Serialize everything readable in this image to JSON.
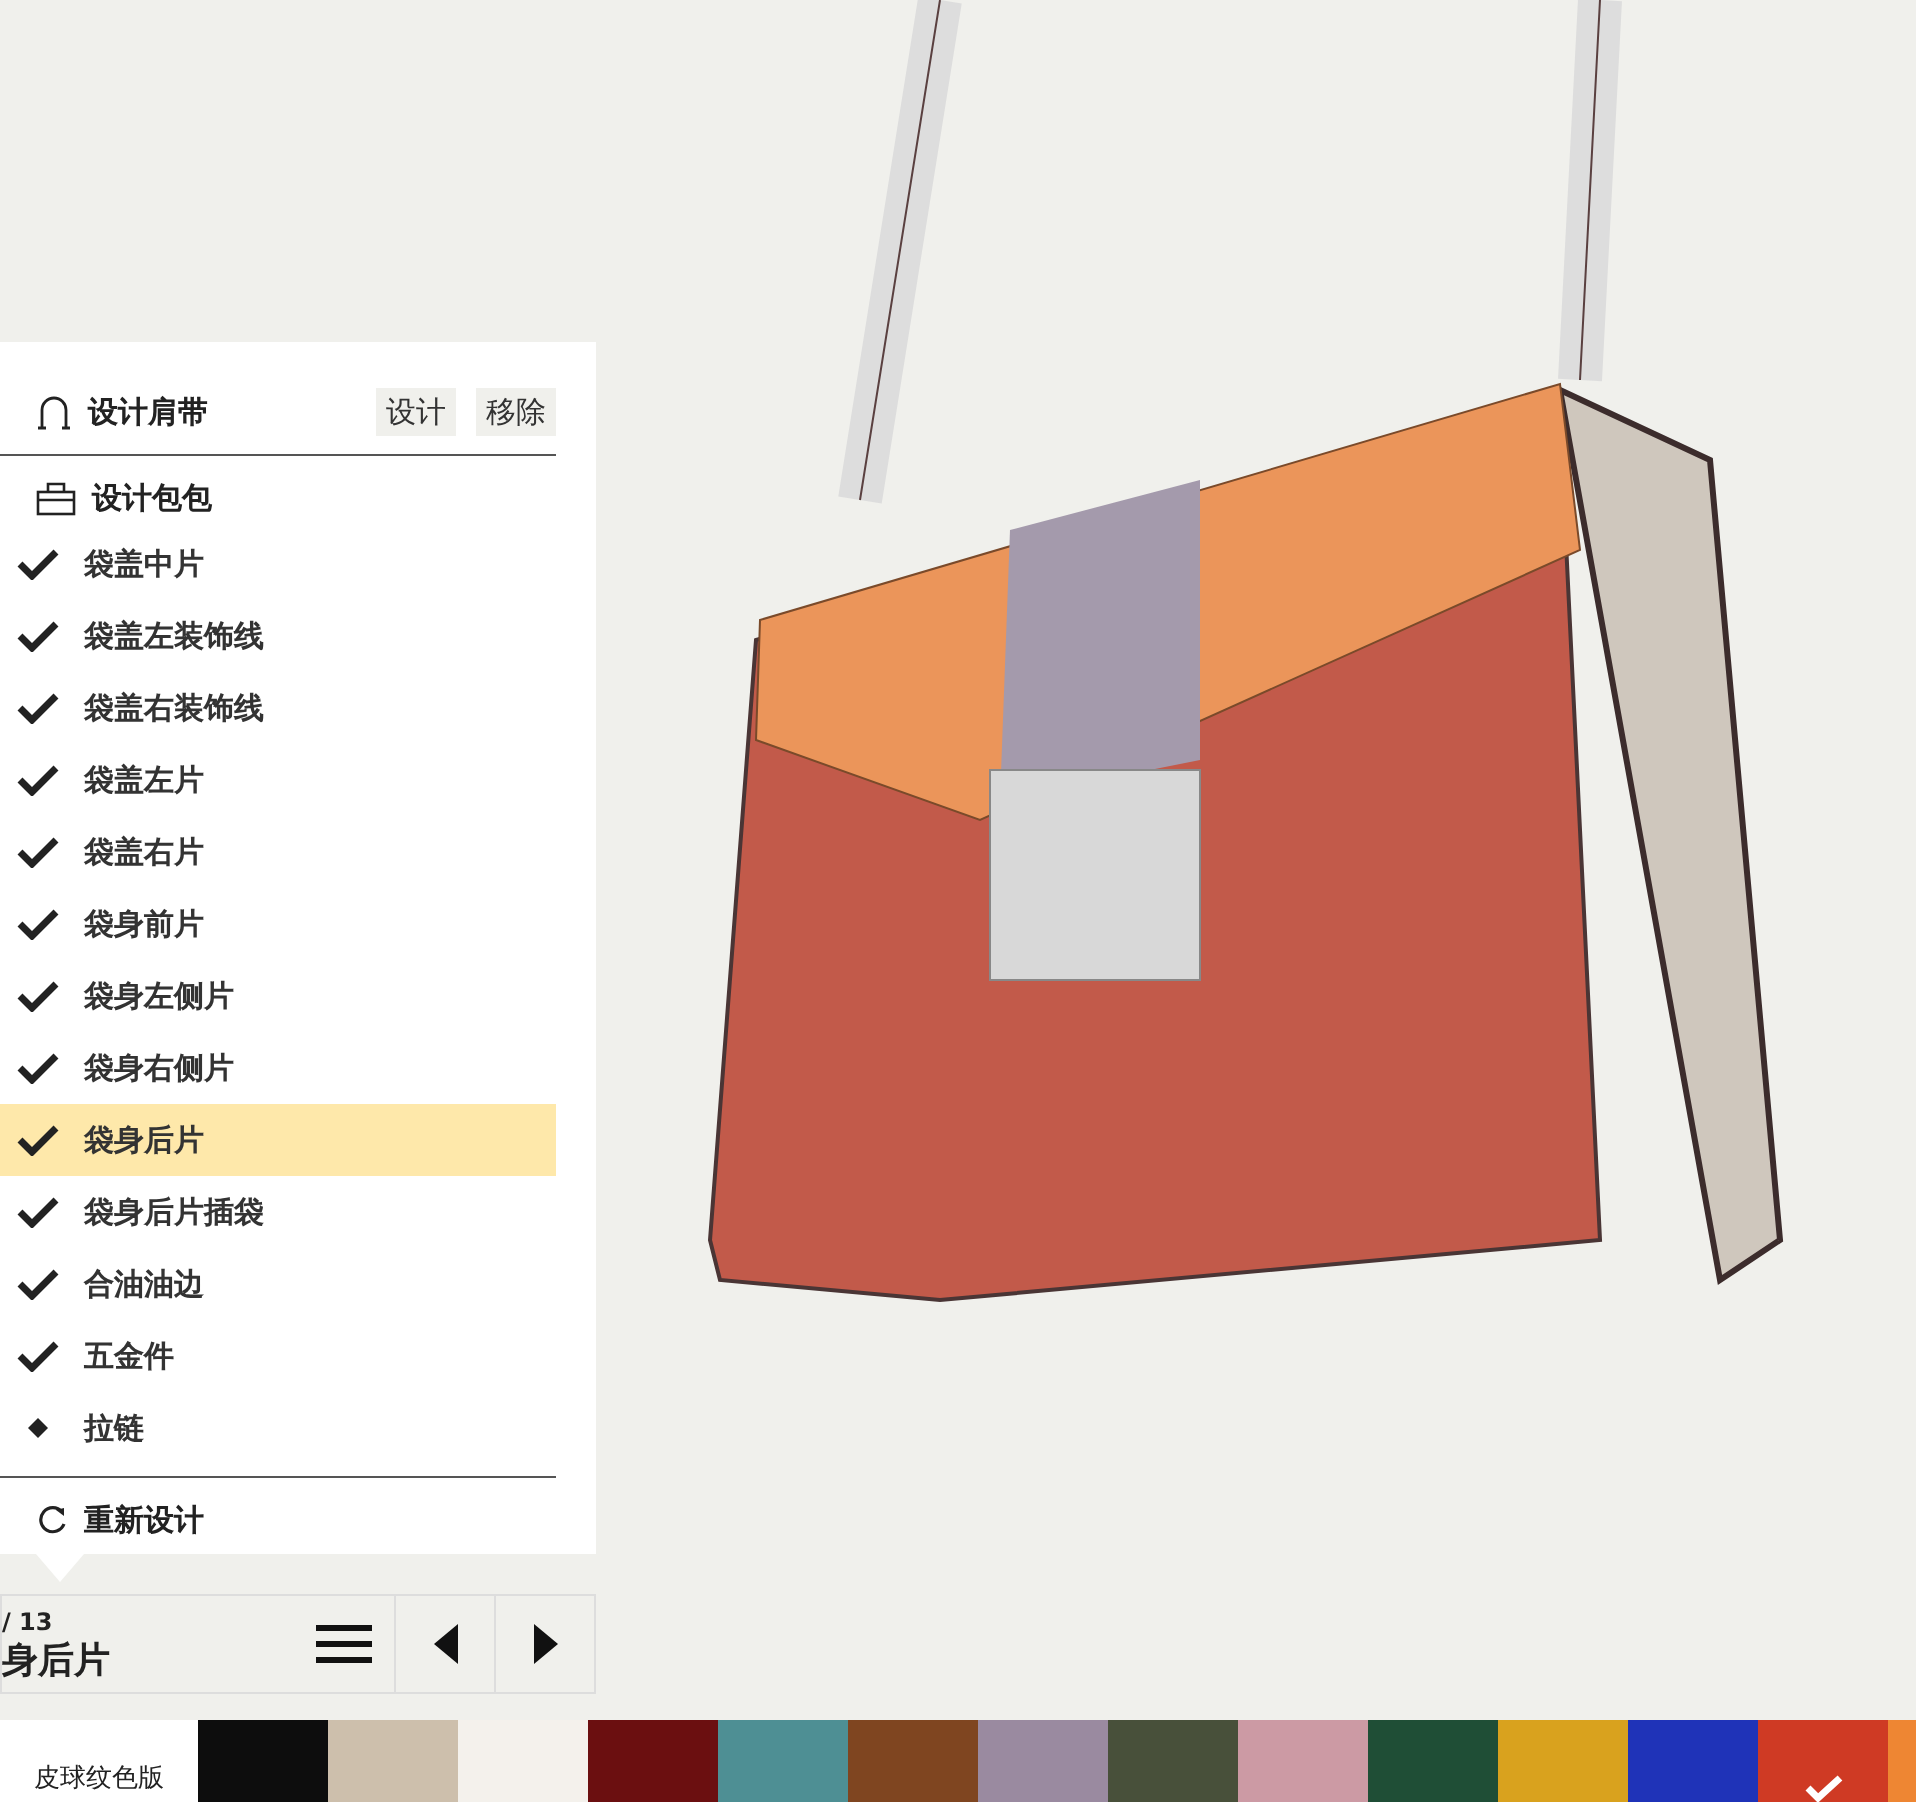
{
  "strap_section": {
    "title": "设计肩带",
    "buttons": [
      "设计",
      "移除"
    ]
  },
  "bag_section": {
    "title": "设计包包"
  },
  "parts": [
    {
      "label": "袋盖中片",
      "kind": "done",
      "selected": false
    },
    {
      "label": "袋盖左装饰线",
      "kind": "done",
      "selected": false
    },
    {
      "label": "袋盖右装饰线",
      "kind": "done",
      "selected": false
    },
    {
      "label": "袋盖左片",
      "kind": "done",
      "selected": false
    },
    {
      "label": "袋盖右片",
      "kind": "done",
      "selected": false
    },
    {
      "label": "袋身前片",
      "kind": "done",
      "selected": false
    },
    {
      "label": "袋身左侧片",
      "kind": "done",
      "selected": false
    },
    {
      "label": "袋身右侧片",
      "kind": "done",
      "selected": false
    },
    {
      "label": "袋身后片",
      "kind": "done",
      "selected": true
    },
    {
      "label": "袋身后片插袋",
      "kind": "done",
      "selected": false
    },
    {
      "label": "合油油边",
      "kind": "done",
      "selected": false
    },
    {
      "label": "五金件",
      "kind": "done",
      "selected": false
    },
    {
      "label": "拉链",
      "kind": "pending",
      "selected": false
    }
  ],
  "redesign": "重新设计",
  "step_nav": {
    "counter": "/ 13",
    "current_part": "身后片"
  },
  "material": {
    "label": "皮球纹色版",
    "swatches": [
      {
        "color": "#0d0d0d",
        "selected": false
      },
      {
        "color": "#cdbfac",
        "selected": false
      },
      {
        "color": "#f4f1ec",
        "selected": false
      },
      {
        "color": "#6b0f10",
        "selected": false
      },
      {
        "color": "#4e8f94",
        "selected": false
      },
      {
        "color": "#7f4520",
        "selected": false
      },
      {
        "color": "#9a8aa0",
        "selected": false
      },
      {
        "color": "#48503a",
        "selected": false
      },
      {
        "color": "#cc9aa4",
        "selected": false
      },
      {
        "color": "#1f4e36",
        "selected": false
      },
      {
        "color": "#d9a21e",
        "selected": false
      },
      {
        "color": "#1f33b8",
        "selected": false
      },
      {
        "color": "#cf3a24",
        "selected": true
      },
      {
        "color": "#ee8633",
        "selected": false
      }
    ]
  }
}
